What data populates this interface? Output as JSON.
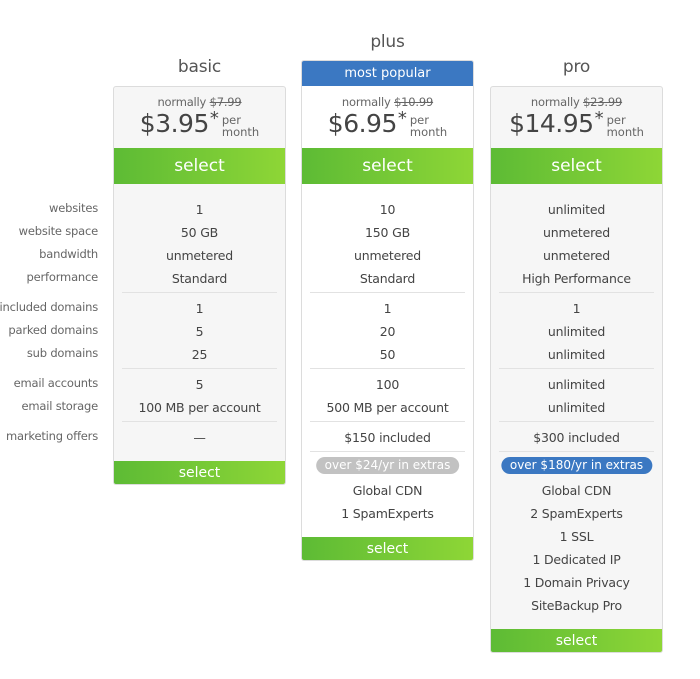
{
  "row_labels": [
    "websites",
    "website space",
    "bandwidth",
    "performance",
    "included domains",
    "parked domains",
    "sub domains",
    "email accounts",
    "email storage",
    "marketing offers"
  ],
  "plans": {
    "basic": {
      "name": "basic",
      "normally_label": "normally",
      "normal_price": "$7.99",
      "price": "$3.95",
      "asterisk": "*",
      "per_1": "per",
      "per_2": "month",
      "select_label": "select",
      "values": [
        "1",
        "50 GB",
        "unmetered",
        "Standard",
        "1",
        "5",
        "25",
        "5",
        "100 MB per account",
        "—"
      ]
    },
    "plus": {
      "name": "plus",
      "badge": "most popular",
      "normally_label": "normally",
      "normal_price": "$10.99",
      "price": "$6.95",
      "asterisk": "*",
      "per_1": "per",
      "per_2": "month",
      "select_label": "select",
      "values": [
        "10",
        "150 GB",
        "unmetered",
        "Standard",
        "1",
        "20",
        "50",
        "100",
        "500 MB per account",
        "$150 included"
      ],
      "extras_pill": "over $24/yr in extras",
      "extras": [
        "Global CDN",
        "1 SpamExperts"
      ]
    },
    "pro": {
      "name": "pro",
      "normally_label": "normally",
      "normal_price": "$23.99",
      "price": "$14.95",
      "asterisk": "*",
      "per_1": "per",
      "per_2": "month",
      "select_label": "select",
      "values": [
        "unlimited",
        "unmetered",
        "unmetered",
        "High Performance",
        "1",
        "unlimited",
        "unlimited",
        "unlimited",
        "unlimited",
        "$300 included"
      ],
      "extras_pill": "over $180/yr in extras",
      "extras": [
        "Global CDN",
        "2 SpamExperts",
        "1 SSL",
        "1 Dedicated IP",
        "1 Domain Privacy",
        "SiteBackup Pro"
      ]
    }
  },
  "colors": {
    "accent_blue": "#3b78c2",
    "select_green_start": "#5dbb35",
    "select_green_end": "#8ed636",
    "pill_gray": "#c2c2c2"
  }
}
